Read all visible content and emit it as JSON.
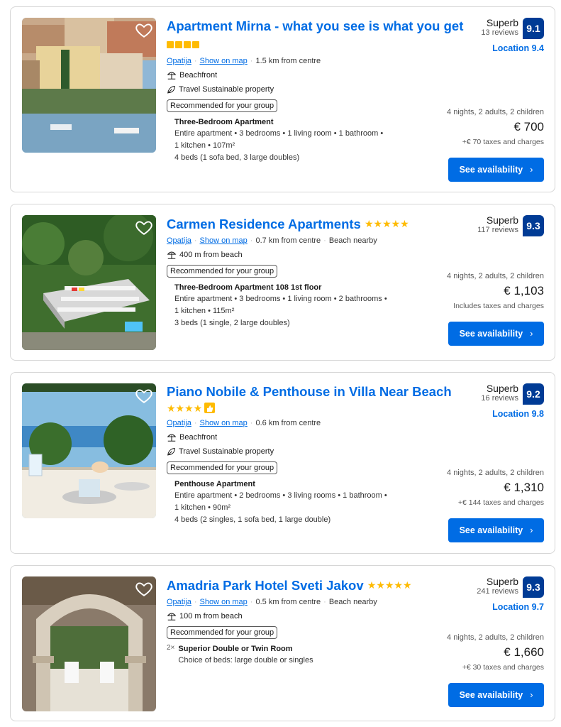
{
  "listings": [
    {
      "title": "Apartment Mirna - what you see is what you get",
      "rating_squares": 4,
      "location_link": "Opatija",
      "map_link": "Show on map",
      "distance": "1.5 km from centre",
      "extra": "",
      "features": [
        "Beachfront",
        "Travel Sustainable property"
      ],
      "recommended": "Recommended for your group",
      "room_title": "Three-Bedroom Apartment",
      "room_desc_1": "Entire apartment • 3 bedrooms • 1 living room • 1 bathroom •",
      "room_desc_2": "1 kitchen • 107m²",
      "room_desc_3": "4 beds (1 sofa bed, 3 large doubles)",
      "score_word": "Superb",
      "reviews": "13 reviews",
      "score": "9.1",
      "location_score": "Location 9.4",
      "stay": "4 nights, 2 adults, 2 children",
      "price": "€ 700",
      "taxes": "+€ 70 taxes and charges",
      "button": "See availability"
    },
    {
      "title": "Carmen Residence Apartments",
      "stars": "★★★★★",
      "location_link": "Opatija",
      "map_link": "Show on map",
      "distance": "0.7 km from centre",
      "extra": "Beach nearby",
      "features": [
        "400 m from beach"
      ],
      "recommended": "Recommended for your group",
      "room_title": "Three-Bedroom Apartment 108 1st floor",
      "room_desc_1": "Entire apartment • 3 bedrooms • 1 living room • 2 bathrooms •",
      "room_desc_2": "1 kitchen • 115m²",
      "room_desc_3": "3 beds (1 single, 2 large doubles)",
      "score_word": "Superb",
      "reviews": "117 reviews",
      "score": "9.3",
      "location_score": "",
      "stay": "4 nights, 2 adults, 2 children",
      "price": "€ 1,103",
      "taxes": "Includes taxes and charges",
      "button": "See availability"
    },
    {
      "title": "Piano Nobile & Penthouse in Villa Near Beach",
      "stars": "★★★★",
      "location_link": "Opatija",
      "map_link": "Show on map",
      "distance": "0.6 km from centre",
      "extra": "",
      "features": [
        "Beachfront",
        "Travel Sustainable property"
      ],
      "recommended": "Recommended for your group",
      "room_title": "Penthouse Apartment",
      "room_desc_1": "Entire apartment • 2 bedrooms • 3 living rooms • 1 bathroom •",
      "room_desc_2": "1 kitchen • 90m²",
      "room_desc_3": "4 beds (2 singles, 1 sofa bed, 1 large double)",
      "score_word": "Superb",
      "reviews": "16 reviews",
      "score": "9.2",
      "location_score": "Location 9.8",
      "stay": "4 nights, 2 adults, 2 children",
      "price": "€ 1,310",
      "taxes": "+€ 144 taxes and charges",
      "button": "See availability"
    },
    {
      "title": "Amadria Park Hotel Sveti Jakov",
      "stars": "★★★★★",
      "location_link": "Opatija",
      "map_link": "Show on map",
      "distance": "0.5 km from centre",
      "extra": "Beach nearby",
      "features": [
        "100 m from beach"
      ],
      "recommended": "Recommended for your group",
      "room_qty": "2×",
      "room_title": "Superior Double or Twin Room",
      "room_desc_1": "Choice of beds: large double or singles",
      "score_word": "Superb",
      "reviews": "241 reviews",
      "score": "9.3",
      "location_score": "Location 9.7",
      "stay": "4 nights, 2 adults, 2 children",
      "price": "€ 1,660",
      "taxes": "+€ 30 taxes and charges",
      "button": "See availability"
    }
  ],
  "icons": {
    "favorite": "heart-icon",
    "beach": "beach-umbrella-icon",
    "sustainable": "leaf-icon",
    "chevron": "chevron-right-icon"
  },
  "colors": {
    "link": "#006ce4",
    "score_badge": "#003b95",
    "stars": "#febb02",
    "button": "#006ce4"
  }
}
